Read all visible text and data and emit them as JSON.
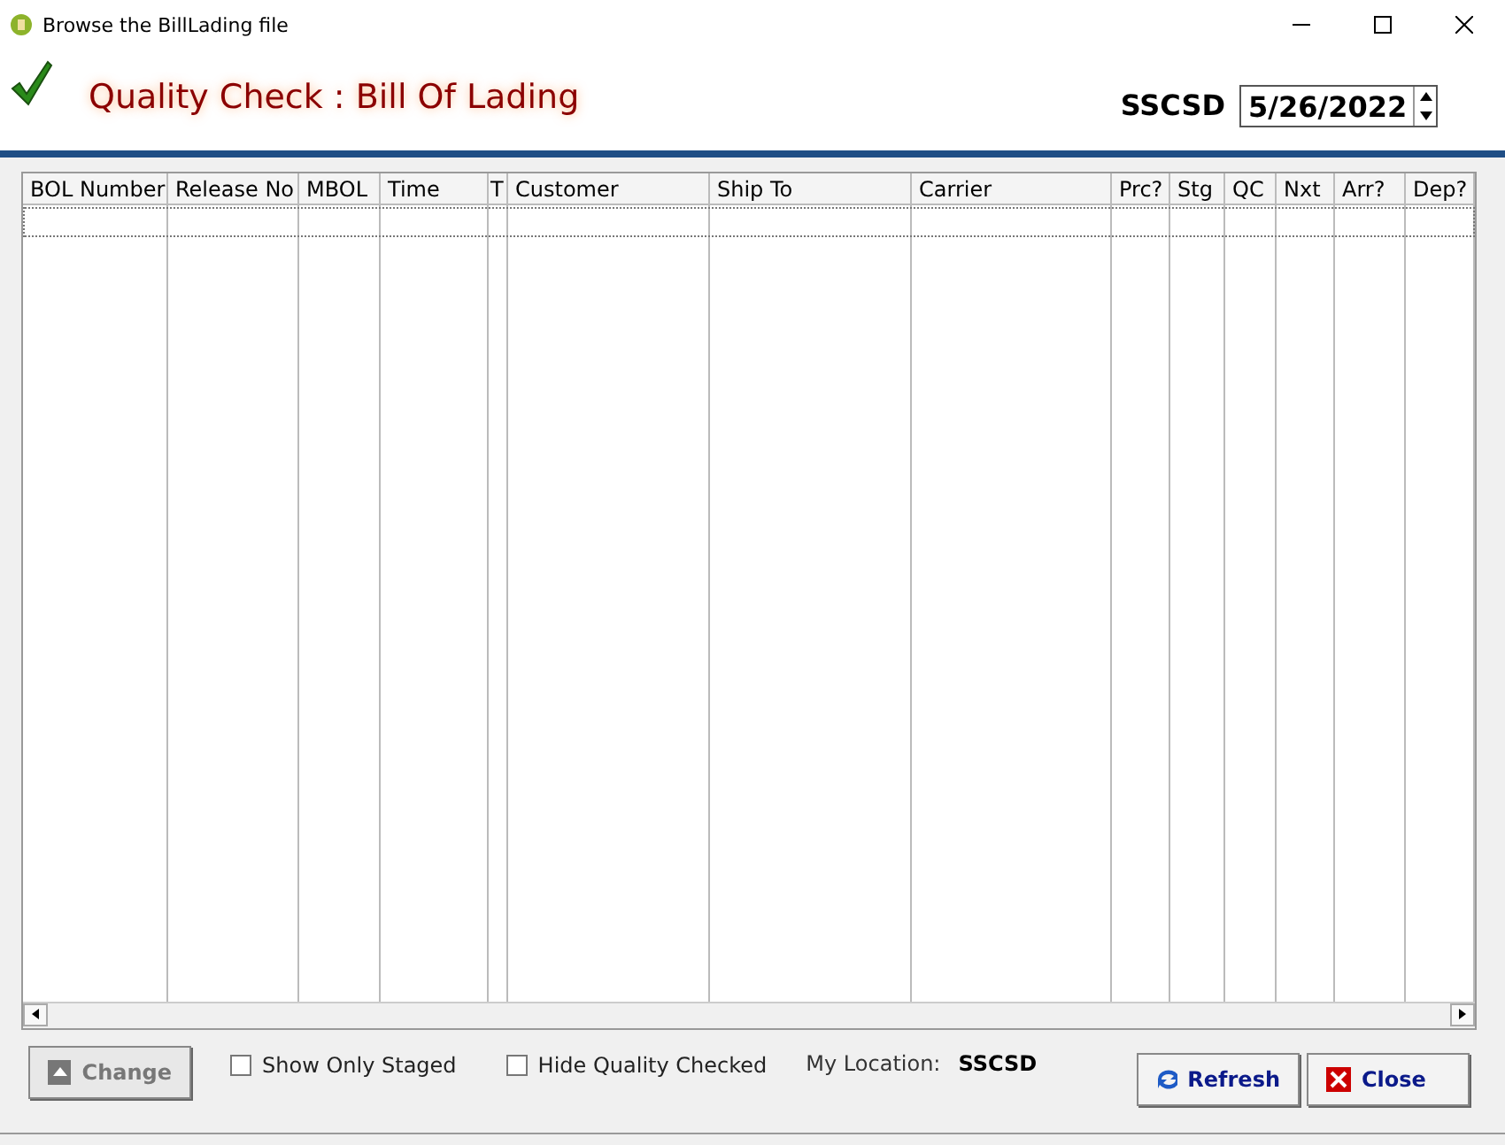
{
  "window": {
    "title": "Browse the BillLading file"
  },
  "header": {
    "title": "Quality Check : Bill Of Lading",
    "location_code": "SSCSD",
    "date": "5/26/2022"
  },
  "table": {
    "columns": [
      {
        "label": "BOL Number"
      },
      {
        "label": "Release No"
      },
      {
        "label": "MBOL"
      },
      {
        "label": "Time"
      },
      {
        "label": "T"
      },
      {
        "label": "Customer"
      },
      {
        "label": "Ship To"
      },
      {
        "label": "Carrier"
      },
      {
        "label": "Prc?"
      },
      {
        "label": "Stg"
      },
      {
        "label": "QC"
      },
      {
        "label": "Nxt"
      },
      {
        "label": "Arr?"
      },
      {
        "label": "Dep?"
      }
    ]
  },
  "options": [
    {
      "label": "Show Only Staged",
      "checked": false
    },
    {
      "label": "Hide Quality Checked",
      "checked": false
    }
  ],
  "location": {
    "label": "My Location:",
    "value": "SSCSD"
  },
  "buttons": [
    {
      "kind": "change",
      "label": "Change",
      "disabled": true
    },
    {
      "kind": "refresh",
      "label": "Refresh",
      "disabled": false
    },
    {
      "kind": "close",
      "label": "Close",
      "disabled": false
    }
  ]
}
